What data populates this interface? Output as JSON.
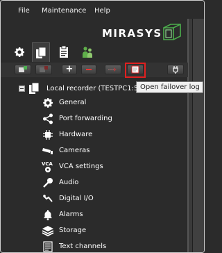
{
  "menu": {
    "file": "File",
    "maintenance": "Maintenance",
    "help": "Help"
  },
  "brand": {
    "logo_text": "MIRASYS"
  },
  "tabs": [
    {
      "icon": "gear-icon",
      "active": false
    },
    {
      "icon": "documents-icon",
      "active": true
    },
    {
      "icon": "clipboard-icon",
      "active": false
    },
    {
      "icon": "users-icon",
      "active": false
    }
  ],
  "toolbar": {
    "buttons": [
      {
        "icon": "add-device-icon",
        "enabled": true
      },
      {
        "icon": "remove-device-icon",
        "enabled": false
      },
      {
        "icon": "plus-icon",
        "enabled": true
      },
      {
        "icon": "minus-icon",
        "enabled": true
      },
      {
        "icon": "move-arrow-icon",
        "enabled": false
      },
      {
        "icon": "failover-log-icon",
        "enabled": true
      },
      {
        "icon": "plug-icon",
        "enabled": true
      }
    ],
    "highlighted_tooltip": "Open failover log"
  },
  "tree": {
    "root_label": "Local recorder (TESTPC1:50",
    "items": [
      {
        "label": "General",
        "icon": "gear-icon"
      },
      {
        "label": "Port forwarding",
        "icon": "share-icon"
      },
      {
        "label": "Hardware",
        "icon": "chip-icon"
      },
      {
        "label": "Cameras",
        "icon": "camera-icon"
      },
      {
        "label": "VCA settings",
        "icon": "vca-icon"
      },
      {
        "label": "Audio",
        "icon": "microphone-icon"
      },
      {
        "label": "Digital I/O",
        "icon": "digital-io-icon"
      },
      {
        "label": "Alarms",
        "icon": "bell-icon"
      },
      {
        "label": "Storage",
        "icon": "layers-icon"
      },
      {
        "label": "Text channels",
        "icon": "text-channel-icon"
      }
    ]
  },
  "colors": {
    "background": "#2b2b2b",
    "highlight": "#e02020",
    "logo_accent": "#4cae4c"
  }
}
